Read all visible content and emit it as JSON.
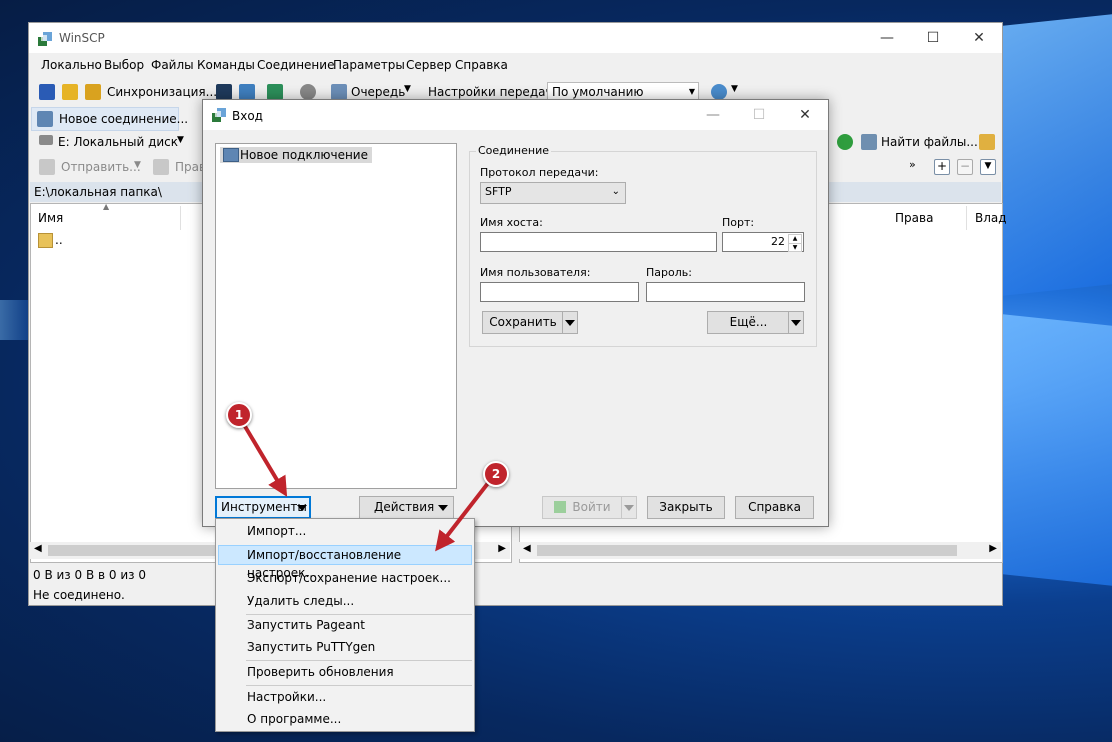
{
  "window": {
    "title": "WinSCP"
  },
  "menubar": [
    "Локально",
    "Выбор",
    "Файлы",
    "Команды",
    "Соединение",
    "Параметры",
    "Сервер",
    "Справка"
  ],
  "toolbar1": {
    "sync": "Синхронизация...",
    "queue": "Очередь",
    "transfer_settings_label": "Настройки передачи",
    "transfer_settings_value": "По умолчанию"
  },
  "tabs": {
    "new_session": "Новое соединение..."
  },
  "local": {
    "drive": "E: Локальный диск",
    "send": "Отправить...",
    "edit": "Прав",
    "path": "E:\\локальная папка\\",
    "col_name": "Имя",
    "parent_dir": "..",
    "status_size": "0 B из 0 B в 0 из 0",
    "status_conn": "Не соединено."
  },
  "remote": {
    "find_files": "Найти файлы...",
    "col_rights": "Права",
    "col_owner": "Влад"
  },
  "dialog": {
    "title": "Вход",
    "site_new": "Новое подключение",
    "group": "Соединение",
    "protocol_label": "Протокол передачи:",
    "protocol_value": "SFTP",
    "host_label": "Имя хоста:",
    "host_value": "",
    "port_label": "Порт:",
    "port_value": "22",
    "user_label": "Имя пользователя:",
    "user_value": "",
    "pass_label": "Пароль:",
    "pass_value": "",
    "save": "Сохранить",
    "more": "Ещё...",
    "tools": "Инструменты",
    "actions": "Действия",
    "login": "Войти",
    "close": "Закрыть",
    "help": "Справка"
  },
  "tools_menu": [
    "Импорт...",
    "Импорт/восстановление настроек...",
    "Экспорт/сохранение настроек...",
    "Удалить следы...",
    "Запустить Pageant",
    "Запустить PuTTYgen",
    "Проверить обновления",
    "Настройки...",
    "О программе..."
  ],
  "annotations": {
    "badge1": "1",
    "badge2": "2"
  },
  "colors": {
    "accent": "#0078d7",
    "badge": "#c0242c",
    "highlight": "#cce8ff",
    "tab_active": "#dfe9f5"
  }
}
